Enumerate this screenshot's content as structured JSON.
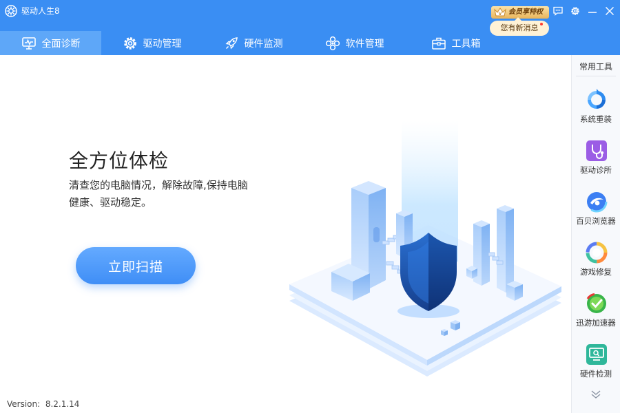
{
  "app": {
    "title": "驱动人生8",
    "version_label": "Version:",
    "version": "8.2.1.14"
  },
  "header": {
    "vip_label": "会员享特权",
    "news_label": "您有新消息"
  },
  "tabs": [
    {
      "label": "全面诊断",
      "icon": "monitor-pulse-icon",
      "active": true
    },
    {
      "label": "驱动管理",
      "icon": "gear-icon",
      "active": false
    },
    {
      "label": "硬件监测",
      "icon": "rocket-icon",
      "active": false
    },
    {
      "label": "软件管理",
      "icon": "flower-icon",
      "active": false
    },
    {
      "label": "工具箱",
      "icon": "toolbox-icon",
      "active": false
    }
  ],
  "main": {
    "heading": "全方位体检",
    "desc_line1": "清查您的电脑情况，解除故障,保持电脑",
    "desc_line2": "健康、驱动稳定。",
    "scan_label": "立即扫描"
  },
  "sidebar": {
    "title": "常用工具",
    "tools": [
      {
        "label": "系统重装",
        "icon": "system-reinstall-icon"
      },
      {
        "label": "驱动诊所",
        "icon": "driver-clinic-icon"
      },
      {
        "label": "百贝浏览器",
        "icon": "browser-icon"
      },
      {
        "label": "游戏修复",
        "icon": "game-repair-icon"
      },
      {
        "label": "迅游加速器",
        "icon": "accelerator-icon"
      },
      {
        "label": "硬件检测",
        "icon": "hardware-check-icon"
      }
    ]
  },
  "colors": {
    "accent": "#3a8ef3",
    "tab_active": "#5ea7f8",
    "shield": "#1d4f9e"
  }
}
